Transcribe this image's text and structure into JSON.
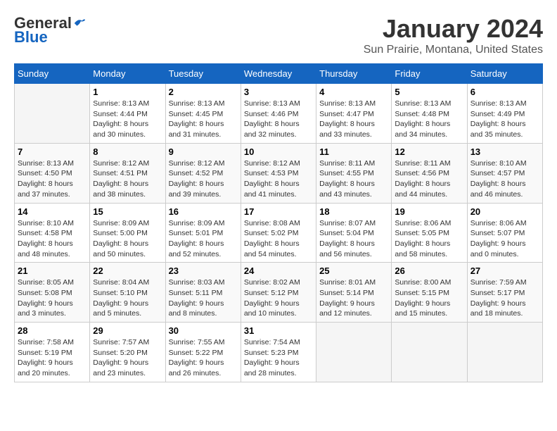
{
  "header": {
    "logo_general": "General",
    "logo_blue": "Blue",
    "title": "January 2024",
    "subtitle": "Sun Prairie, Montana, United States"
  },
  "days_of_week": [
    "Sunday",
    "Monday",
    "Tuesday",
    "Wednesday",
    "Thursday",
    "Friday",
    "Saturday"
  ],
  "weeks": [
    [
      {
        "day": "",
        "info": ""
      },
      {
        "day": "1",
        "info": "Sunrise: 8:13 AM\nSunset: 4:44 PM\nDaylight: 8 hours\nand 30 minutes."
      },
      {
        "day": "2",
        "info": "Sunrise: 8:13 AM\nSunset: 4:45 PM\nDaylight: 8 hours\nand 31 minutes."
      },
      {
        "day": "3",
        "info": "Sunrise: 8:13 AM\nSunset: 4:46 PM\nDaylight: 8 hours\nand 32 minutes."
      },
      {
        "day": "4",
        "info": "Sunrise: 8:13 AM\nSunset: 4:47 PM\nDaylight: 8 hours\nand 33 minutes."
      },
      {
        "day": "5",
        "info": "Sunrise: 8:13 AM\nSunset: 4:48 PM\nDaylight: 8 hours\nand 34 minutes."
      },
      {
        "day": "6",
        "info": "Sunrise: 8:13 AM\nSunset: 4:49 PM\nDaylight: 8 hours\nand 35 minutes."
      }
    ],
    [
      {
        "day": "7",
        "info": "Sunrise: 8:13 AM\nSunset: 4:50 PM\nDaylight: 8 hours\nand 37 minutes."
      },
      {
        "day": "8",
        "info": "Sunrise: 8:12 AM\nSunset: 4:51 PM\nDaylight: 8 hours\nand 38 minutes."
      },
      {
        "day": "9",
        "info": "Sunrise: 8:12 AM\nSunset: 4:52 PM\nDaylight: 8 hours\nand 39 minutes."
      },
      {
        "day": "10",
        "info": "Sunrise: 8:12 AM\nSunset: 4:53 PM\nDaylight: 8 hours\nand 41 minutes."
      },
      {
        "day": "11",
        "info": "Sunrise: 8:11 AM\nSunset: 4:55 PM\nDaylight: 8 hours\nand 43 minutes."
      },
      {
        "day": "12",
        "info": "Sunrise: 8:11 AM\nSunset: 4:56 PM\nDaylight: 8 hours\nand 44 minutes."
      },
      {
        "day": "13",
        "info": "Sunrise: 8:10 AM\nSunset: 4:57 PM\nDaylight: 8 hours\nand 46 minutes."
      }
    ],
    [
      {
        "day": "14",
        "info": "Sunrise: 8:10 AM\nSunset: 4:58 PM\nDaylight: 8 hours\nand 48 minutes."
      },
      {
        "day": "15",
        "info": "Sunrise: 8:09 AM\nSunset: 5:00 PM\nDaylight: 8 hours\nand 50 minutes."
      },
      {
        "day": "16",
        "info": "Sunrise: 8:09 AM\nSunset: 5:01 PM\nDaylight: 8 hours\nand 52 minutes."
      },
      {
        "day": "17",
        "info": "Sunrise: 8:08 AM\nSunset: 5:02 PM\nDaylight: 8 hours\nand 54 minutes."
      },
      {
        "day": "18",
        "info": "Sunrise: 8:07 AM\nSunset: 5:04 PM\nDaylight: 8 hours\nand 56 minutes."
      },
      {
        "day": "19",
        "info": "Sunrise: 8:06 AM\nSunset: 5:05 PM\nDaylight: 8 hours\nand 58 minutes."
      },
      {
        "day": "20",
        "info": "Sunrise: 8:06 AM\nSunset: 5:07 PM\nDaylight: 9 hours\nand 0 minutes."
      }
    ],
    [
      {
        "day": "21",
        "info": "Sunrise: 8:05 AM\nSunset: 5:08 PM\nDaylight: 9 hours\nand 3 minutes."
      },
      {
        "day": "22",
        "info": "Sunrise: 8:04 AM\nSunset: 5:10 PM\nDaylight: 9 hours\nand 5 minutes."
      },
      {
        "day": "23",
        "info": "Sunrise: 8:03 AM\nSunset: 5:11 PM\nDaylight: 9 hours\nand 8 minutes."
      },
      {
        "day": "24",
        "info": "Sunrise: 8:02 AM\nSunset: 5:12 PM\nDaylight: 9 hours\nand 10 minutes."
      },
      {
        "day": "25",
        "info": "Sunrise: 8:01 AM\nSunset: 5:14 PM\nDaylight: 9 hours\nand 12 minutes."
      },
      {
        "day": "26",
        "info": "Sunrise: 8:00 AM\nSunset: 5:15 PM\nDaylight: 9 hours\nand 15 minutes."
      },
      {
        "day": "27",
        "info": "Sunrise: 7:59 AM\nSunset: 5:17 PM\nDaylight: 9 hours\nand 18 minutes."
      }
    ],
    [
      {
        "day": "28",
        "info": "Sunrise: 7:58 AM\nSunset: 5:19 PM\nDaylight: 9 hours\nand 20 minutes."
      },
      {
        "day": "29",
        "info": "Sunrise: 7:57 AM\nSunset: 5:20 PM\nDaylight: 9 hours\nand 23 minutes."
      },
      {
        "day": "30",
        "info": "Sunrise: 7:55 AM\nSunset: 5:22 PM\nDaylight: 9 hours\nand 26 minutes."
      },
      {
        "day": "31",
        "info": "Sunrise: 7:54 AM\nSunset: 5:23 PM\nDaylight: 9 hours\nand 28 minutes."
      },
      {
        "day": "",
        "info": ""
      },
      {
        "day": "",
        "info": ""
      },
      {
        "day": "",
        "info": ""
      }
    ]
  ]
}
